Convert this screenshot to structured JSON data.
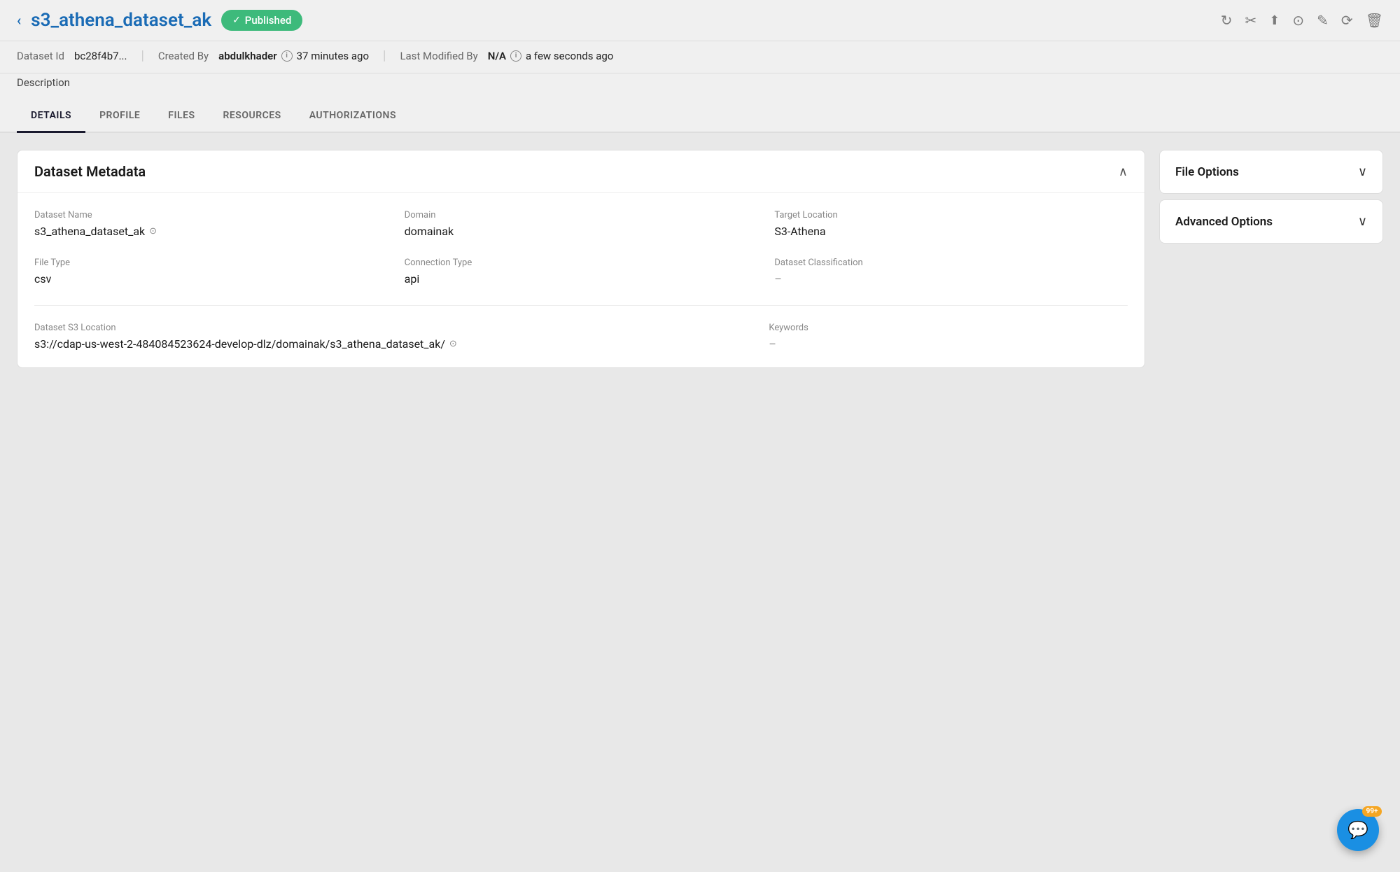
{
  "header": {
    "back_label": "‹",
    "title": "s3_athena_dataset_ak",
    "published_label": "Published",
    "check_mark": "✓"
  },
  "toolbar": {
    "icons": [
      {
        "name": "refresh-icon",
        "symbol": "↻"
      },
      {
        "name": "scissors-icon",
        "symbol": "✂"
      },
      {
        "name": "share-icon",
        "symbol": "↑"
      },
      {
        "name": "search-icon",
        "symbol": "⊙"
      },
      {
        "name": "edit-icon",
        "symbol": "✎"
      },
      {
        "name": "history-icon",
        "symbol": "⟳"
      },
      {
        "name": "delete-icon",
        "symbol": "🗑"
      }
    ]
  },
  "meta": {
    "dataset_id_label": "Dataset Id",
    "dataset_id_value": "bc28f4b7...",
    "created_by_label": "Created By",
    "created_by_value": "abdulkhader",
    "created_time": "37 minutes ago",
    "last_modified_label": "Last Modified By",
    "last_modified_value": "N/A",
    "last_modified_time": "a few seconds ago"
  },
  "description": {
    "label": "Description"
  },
  "tabs": [
    {
      "id": "details",
      "label": "DETAILS",
      "active": true
    },
    {
      "id": "profile",
      "label": "PROFILE",
      "active": false
    },
    {
      "id": "files",
      "label": "FILES",
      "active": false
    },
    {
      "id": "resources",
      "label": "RESOURCES",
      "active": false
    },
    {
      "id": "authorizations",
      "label": "AUTHORIZATIONS",
      "active": false
    }
  ],
  "metadata_card": {
    "title": "Dataset Metadata",
    "fields": {
      "dataset_name_label": "Dataset Name",
      "dataset_name_value": "s3_athena_dataset_ak",
      "domain_label": "Domain",
      "domain_value": "domainak",
      "target_location_label": "Target Location",
      "target_location_value": "S3-Athena",
      "file_type_label": "File Type",
      "file_type_value": "csv",
      "connection_type_label": "Connection Type",
      "connection_type_value": "api",
      "dataset_classification_label": "Dataset Classification",
      "dataset_classification_value": "–",
      "s3_location_label": "Dataset S3 Location",
      "s3_location_value": "s3://cdap-us-west-2-484084523624-develop-dlz/domainak/s3_athena_dataset_ak/",
      "keywords_label": "Keywords",
      "keywords_value": "–"
    }
  },
  "right_panel": {
    "file_options_label": "File Options",
    "advanced_options_label": "Advanced Options"
  },
  "chat": {
    "badge": "99+",
    "icon": "💬"
  }
}
